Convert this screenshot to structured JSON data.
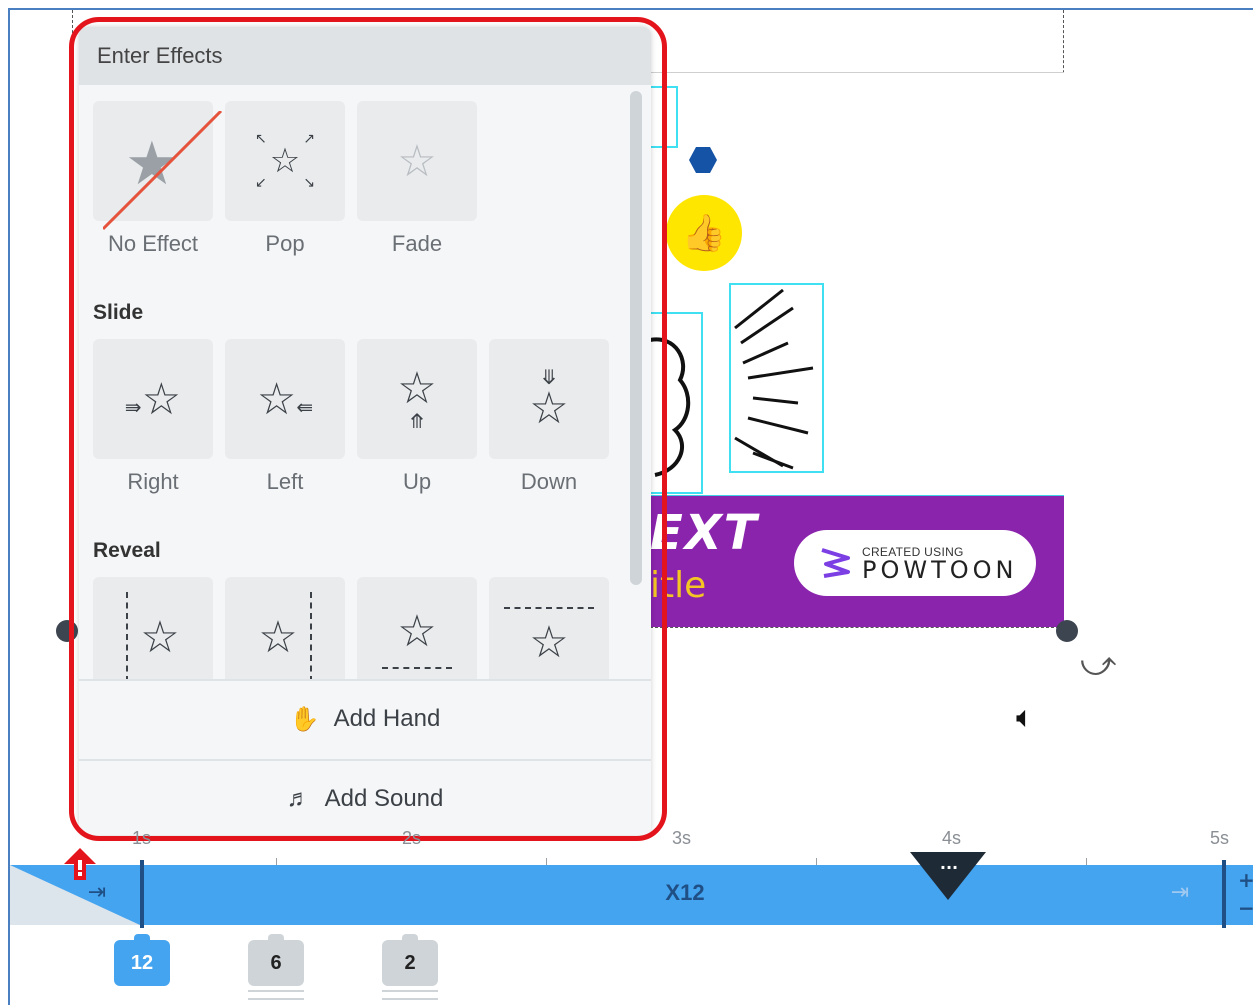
{
  "panel": {
    "title": "Enter Effects",
    "sections": [
      {
        "label": "",
        "items": [
          {
            "label": "No Effect",
            "icon": "no-effect-icon"
          },
          {
            "label": "Pop",
            "icon": "pop-icon"
          },
          {
            "label": "Fade",
            "icon": "fade-icon"
          }
        ]
      },
      {
        "label": "Slide",
        "items": [
          {
            "label": "Right",
            "icon": "slide-right-icon"
          },
          {
            "label": "Left",
            "icon": "slide-left-icon"
          },
          {
            "label": "Up",
            "icon": "slide-up-icon"
          },
          {
            "label": "Down",
            "icon": "slide-down-icon"
          }
        ]
      },
      {
        "label": "Reveal",
        "items": [
          {
            "label": "",
            "icon": "reveal-right-icon"
          },
          {
            "label": "",
            "icon": "reveal-left-icon"
          },
          {
            "label": "",
            "icon": "reveal-up-icon"
          },
          {
            "label": "",
            "icon": "reveal-down-icon"
          }
        ]
      }
    ],
    "actions": {
      "add_hand": "Add Hand",
      "add_sound": "Add Sound"
    }
  },
  "canvas": {
    "band_text_line1": "EXT",
    "band_text_line2": "itle",
    "badge_small": "CREATED USING",
    "badge_big": "POWTOON"
  },
  "timeline": {
    "ticks": [
      "1s",
      "2s",
      "3s",
      "4s",
      "5s"
    ],
    "track_label": "X12",
    "playhead_label": "...",
    "zoom_plus": "+",
    "zoom_minus": "−",
    "badges": [
      {
        "value": "12",
        "active": true
      },
      {
        "value": "6",
        "active": false
      },
      {
        "value": "2",
        "active": false
      }
    ]
  },
  "colors": {
    "accent": "#44a4f0",
    "highlight": "#e3141c",
    "band": "#8b24ad"
  }
}
